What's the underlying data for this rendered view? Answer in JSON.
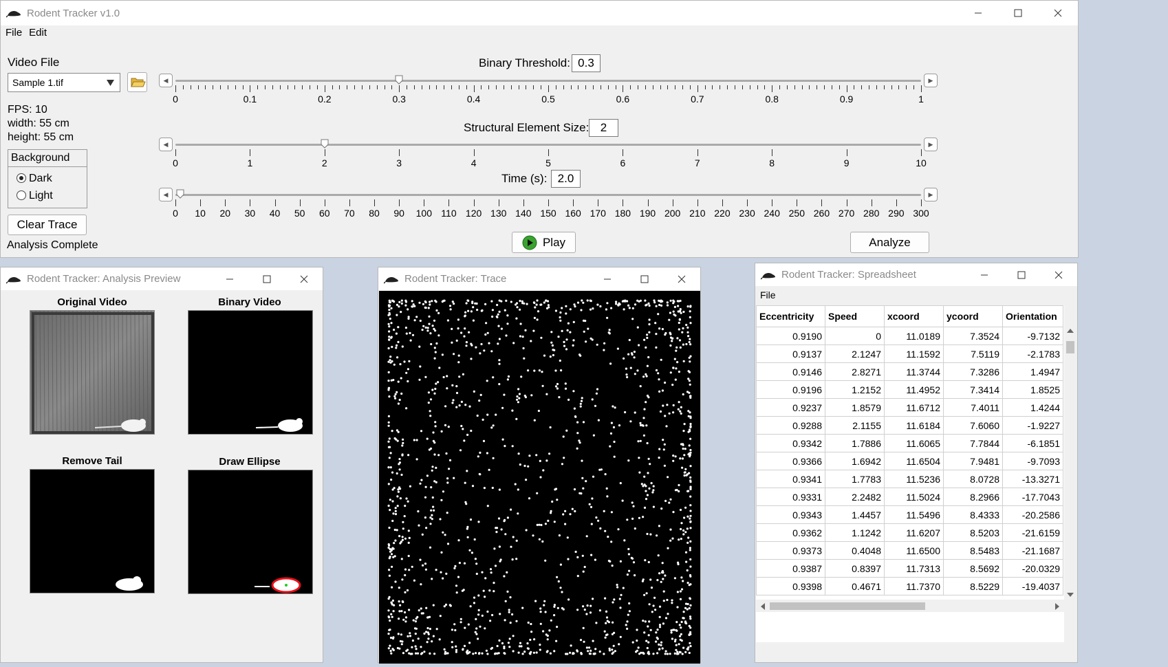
{
  "main": {
    "title": "Rodent Tracker v1.0",
    "menu": [
      "File",
      "Edit"
    ],
    "video_file_label": "Video File",
    "video_file_selected": "Sample 1.tif",
    "fps": "FPS: 10",
    "width": "width: 55 cm",
    "height": "height: 55 cm",
    "background_label": "Background",
    "background_options": [
      "Dark",
      "Light"
    ],
    "background_selected": "Dark",
    "clear_trace_label": "Clear Trace",
    "status": "Analysis Complete",
    "binary_threshold_label": "Binary Threshold:",
    "binary_threshold_value": "0.3",
    "binary_threshold_fraction": 0.3,
    "binary_threshold_ticks": [
      "0",
      "0.1",
      "0.2",
      "0.3",
      "0.4",
      "0.5",
      "0.6",
      "0.7",
      "0.8",
      "0.9",
      "1"
    ],
    "struct_label": "Structural Element Size:",
    "struct_value": "2",
    "struct_fraction": 0.2,
    "struct_ticks": [
      "0",
      "1",
      "2",
      "3",
      "4",
      "5",
      "6",
      "7",
      "8",
      "9",
      "10"
    ],
    "time_label": "Time (s):",
    "time_value": "2.0",
    "time_fraction": 0.0067,
    "time_ticks": [
      "0",
      "10",
      "20",
      "30",
      "40",
      "50",
      "60",
      "70",
      "80",
      "90",
      "100",
      "110",
      "120",
      "130",
      "140",
      "150",
      "160",
      "170",
      "180",
      "190",
      "200",
      "210",
      "220",
      "230",
      "240",
      "250",
      "260",
      "270",
      "280",
      "290",
      "300"
    ],
    "play_label": "Play",
    "analyze_label": "Analyze"
  },
  "preview": {
    "title": "Rodent Tracker: Analysis Preview",
    "panes": [
      "Original Video",
      "Binary Video",
      "Remove Tail",
      "Draw Ellipse"
    ]
  },
  "trace": {
    "title": "Rodent Tracker: Trace"
  },
  "spreadsheet": {
    "title": "Rodent Tracker: Spreadsheet",
    "menu": [
      "File"
    ],
    "columns": [
      "Eccentricity",
      "Speed",
      "xcoord",
      "ycoord",
      "Orientation"
    ],
    "rows": [
      [
        "0.9190",
        "0",
        "11.0189",
        "7.3524",
        "-9.7132"
      ],
      [
        "0.9137",
        "2.1247",
        "11.1592",
        "7.5119",
        "-2.1783"
      ],
      [
        "0.9146",
        "2.8271",
        "11.3744",
        "7.3286",
        "1.4947"
      ],
      [
        "0.9196",
        "1.2152",
        "11.4952",
        "7.3414",
        "1.8525"
      ],
      [
        "0.9237",
        "1.8579",
        "11.6712",
        "7.4011",
        "1.4244"
      ],
      [
        "0.9288",
        "2.1155",
        "11.6184",
        "7.6060",
        "-1.9227"
      ],
      [
        "0.9342",
        "1.7886",
        "11.6065",
        "7.7844",
        "-6.1851"
      ],
      [
        "0.9366",
        "1.6942",
        "11.6504",
        "7.9481",
        "-9.7093"
      ],
      [
        "0.9341",
        "1.7783",
        "11.5236",
        "8.0728",
        "-13.3271"
      ],
      [
        "0.9331",
        "2.2482",
        "11.5024",
        "8.2966",
        "-17.7043"
      ],
      [
        "0.9343",
        "1.4457",
        "11.5496",
        "8.4333",
        "-20.2586"
      ],
      [
        "0.9362",
        "1.1242",
        "11.6207",
        "8.5203",
        "-21.6159"
      ],
      [
        "0.9373",
        "0.4048",
        "11.6500",
        "8.5483",
        "-21.1687"
      ],
      [
        "0.9387",
        "0.8397",
        "11.7313",
        "8.5692",
        "-20.0329"
      ],
      [
        "0.9398",
        "0.4671",
        "11.7370",
        "8.5229",
        "-19.4037"
      ]
    ]
  },
  "colors": {
    "ellipse": "#e8101a",
    "centroid": "#22cc22",
    "play_icon": "#3aa330"
  }
}
